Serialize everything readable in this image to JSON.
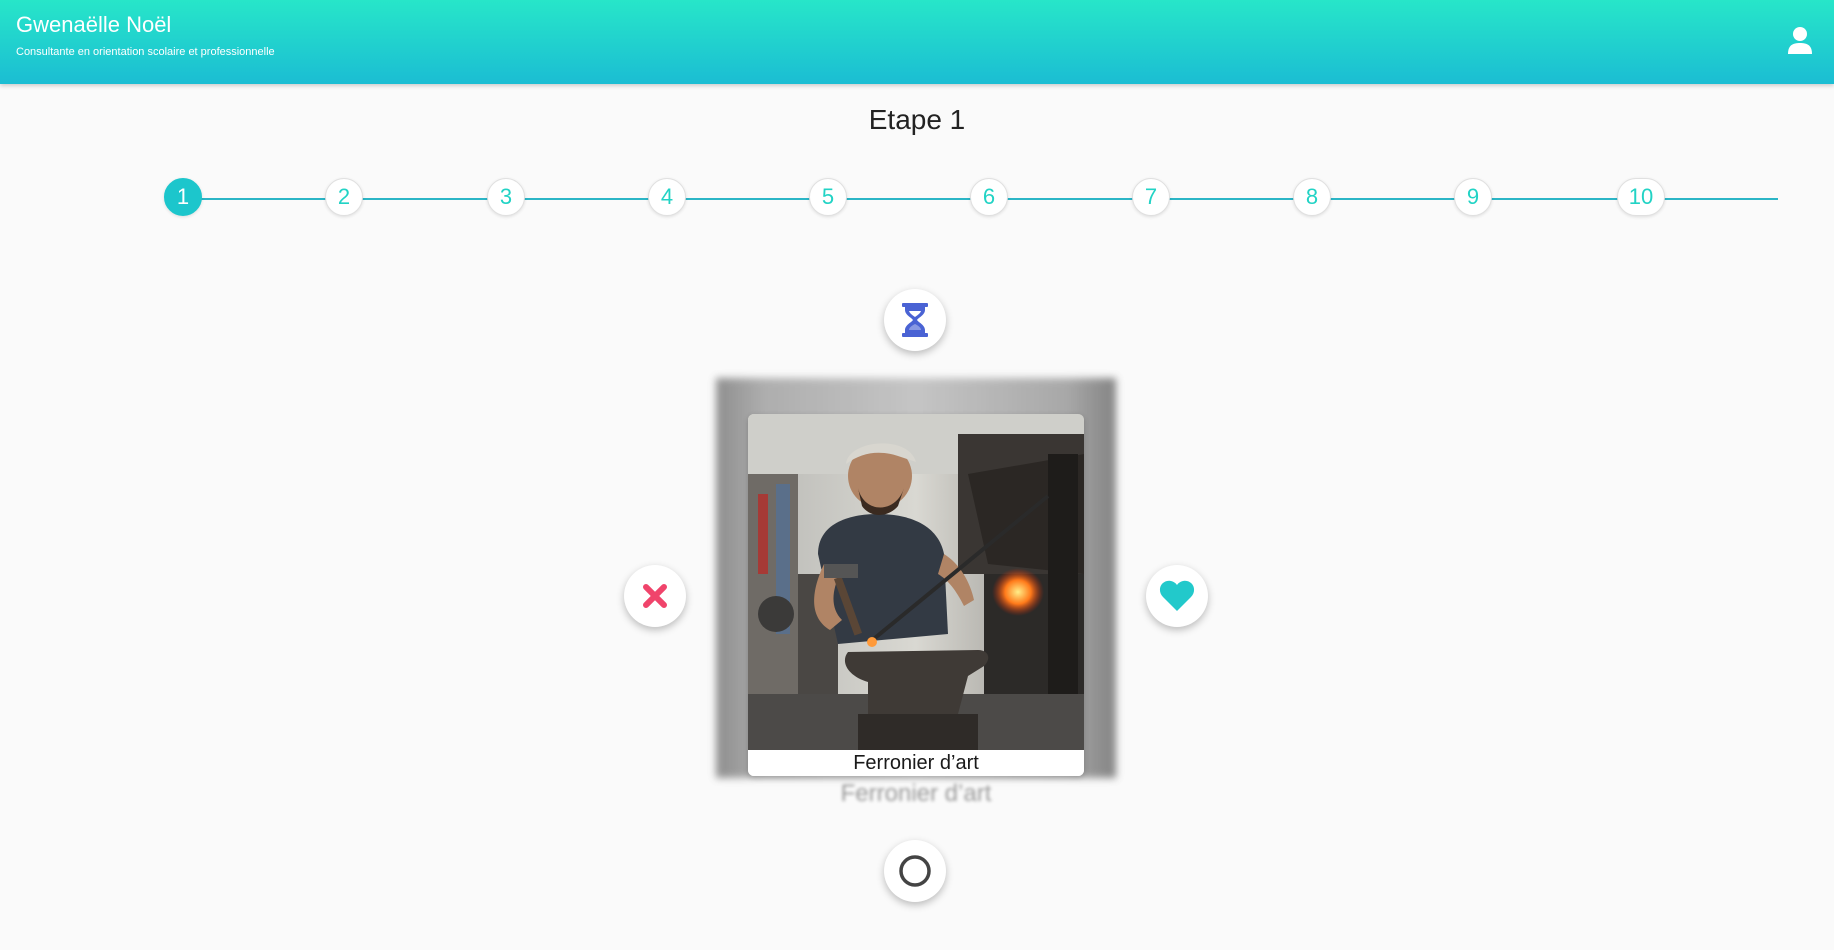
{
  "header": {
    "title": "Gwenaëlle Noël",
    "subtitle": "Consultante en orientation scolaire et professionnelle",
    "user_icon": "user-icon"
  },
  "page": {
    "title": "Etape 1"
  },
  "stepper": {
    "active_step": 1,
    "steps": [
      "1",
      "2",
      "3",
      "4",
      "5",
      "6",
      "7",
      "8",
      "9",
      "10"
    ]
  },
  "actions": {
    "wait_icon": "hourglass-icon",
    "reject_icon": "close-icon",
    "like_icon": "heart-icon",
    "neutral_icon": "circle-icon"
  },
  "card": {
    "label": "Ferronier d’art",
    "shadow_label": "Ferronier d’art"
  },
  "colors": {
    "header_start": "#27e6c9",
    "header_end": "#1bbdd3",
    "accent": "#1cc6cc",
    "reject": "#f0446b",
    "like": "#22c9cb",
    "wait": "#4a63d4"
  }
}
